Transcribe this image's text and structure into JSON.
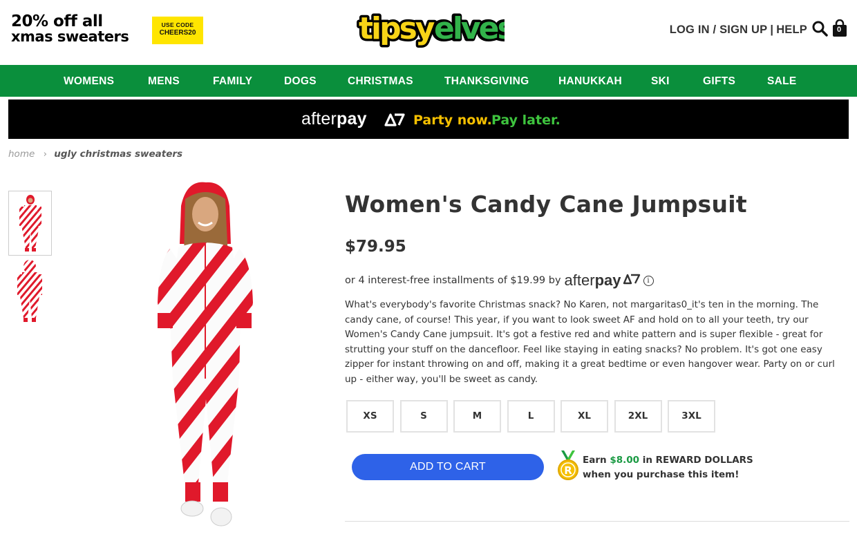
{
  "promo": {
    "line1": "20% off all",
    "line2": "xmas sweaters",
    "code_label": "USE CODE",
    "code": "CHEERS20"
  },
  "logo": {
    "text": "tipsyelves"
  },
  "account": {
    "login": "LOG IN / SIGN UP",
    "separator": "|",
    "help": "HELP",
    "cart_count": "0"
  },
  "nav": {
    "items": [
      "WOMENS",
      "MENS",
      "FAMILY",
      "DOGS",
      "CHRISTMAS",
      "THANKSGIVING",
      "HANUKKAH",
      "SKI",
      "GIFTS",
      "SALE"
    ]
  },
  "afterpay_banner": {
    "brand_regular": "after",
    "brand_bold": "pay",
    "tagline_part1": "Party now.",
    "tagline_part2": "Pay later."
  },
  "breadcrumb": {
    "home": "home",
    "current": "ugly christmas sweaters"
  },
  "product": {
    "title": "Women's Candy Cane Jumpsuit",
    "price": "$79.95",
    "installments_text": "or 4 interest-free installments of $19.99 by",
    "afterpay_regular": "after",
    "afterpay_bold": "pay",
    "info_symbol": "i",
    "description": "What's everybody's favorite Christmas snack? No Karen, not margaritas0_it's ten in the morning. The candy cane, of course! This year, if you want to look sweet AF and hold on to all your teeth, try our Women's Candy Cane jumpsuit. It's got a festive red and white pattern and is super flexible - great for strutting your stuff on the dancefloor. Feel like staying in eating snacks? No problem. It's got one easy zipper for instant throwing on and off, making it a great bedtime or even hangover wear. Party on or curl up - either way, you'll be sweet as candy.",
    "sizes": [
      "XS",
      "S",
      "M",
      "L",
      "XL",
      "2XL",
      "3XL"
    ],
    "add_to_cart": "ADD TO CART"
  },
  "reward": {
    "prefix": "Earn",
    "amount": "$8.00",
    "suffix": "in REWARD DOLLARS",
    "line2": "when you purchase this item!",
    "medal_letter": "R"
  },
  "colors": {
    "nav_green": "#0a8f3c",
    "promo_yellow": "#ffe500",
    "afterpay_yellow": "#f6c000",
    "afterpay_green": "#3ec43e",
    "cart_blue": "#2e62e8",
    "reward_green": "#1a9a43",
    "candy_red": "#e0192b"
  },
  "icons": {
    "search": "search-icon",
    "bag": "shopping-bag-icon",
    "breadcrumb_sep": "chevron-right-icon",
    "info": "info-icon",
    "medal": "medal-icon"
  }
}
